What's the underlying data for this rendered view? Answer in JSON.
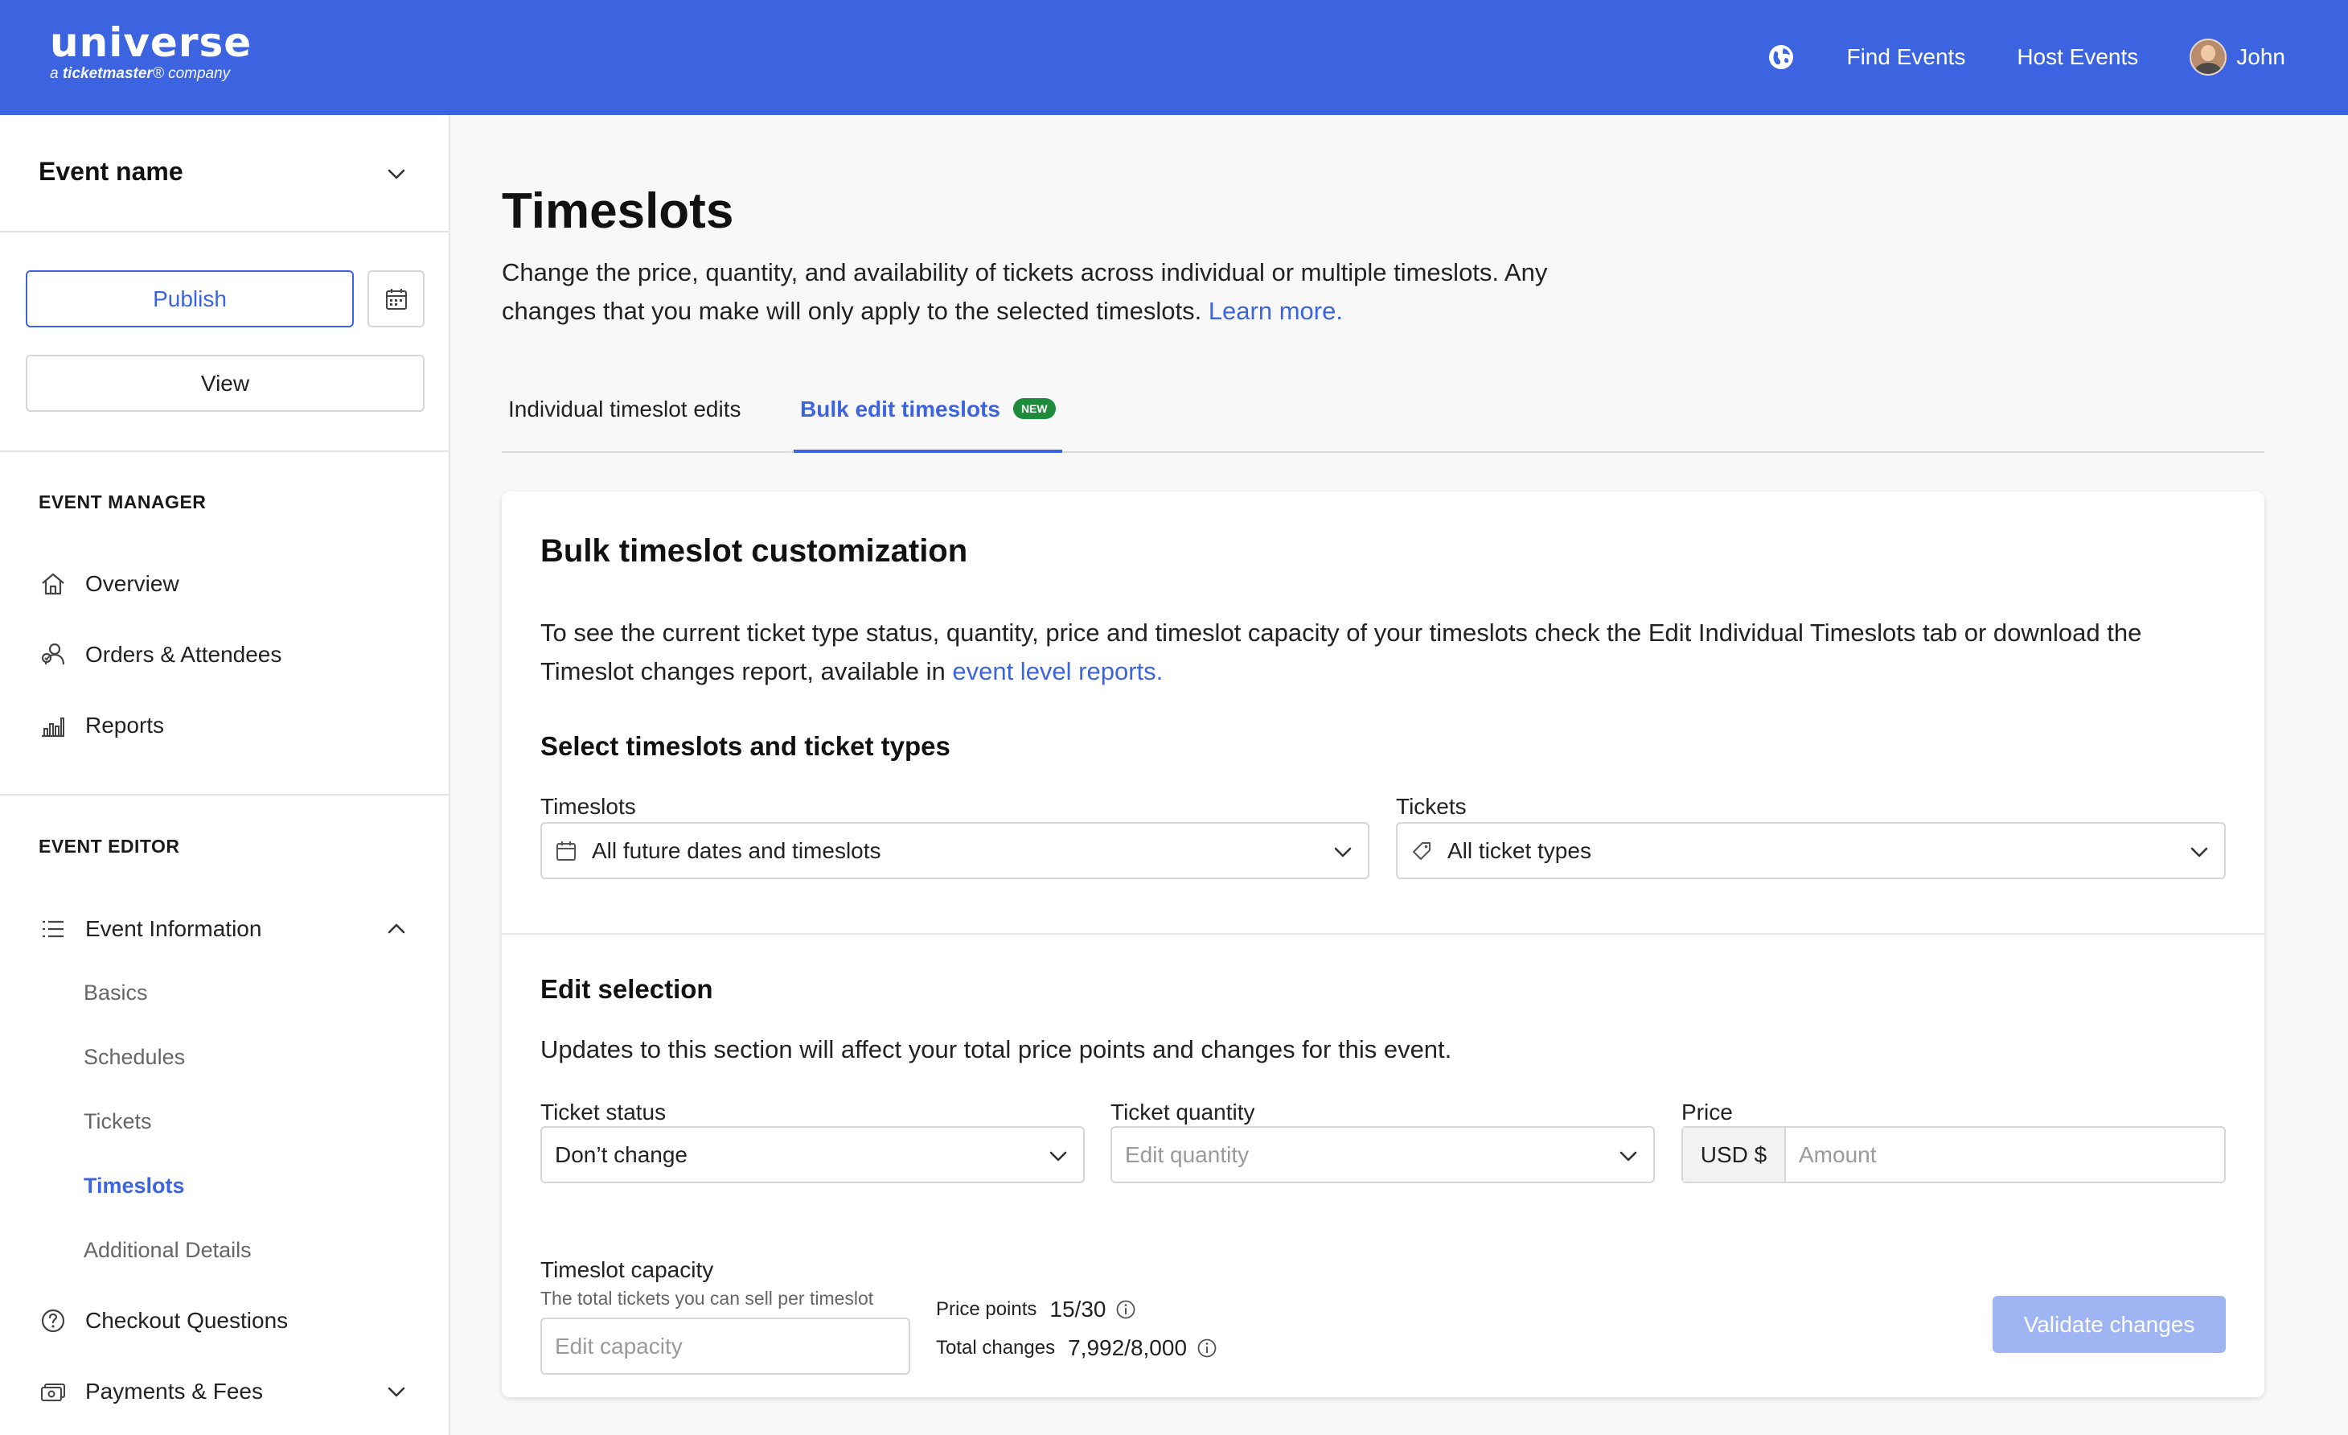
{
  "header": {
    "logo_main": "universe",
    "logo_sub_prefix": "a ",
    "logo_sub_brand": "ticketmaster",
    "logo_sub_suffix": "® company",
    "nav": {
      "find_events": "Find Events",
      "host_events": "Host Events",
      "user_name": "John"
    }
  },
  "sidebar": {
    "event_selector": "Event name",
    "publish_label": "Publish",
    "view_label": "View",
    "event_manager_heading": "EVENT MANAGER",
    "manager_items": [
      {
        "label": "Overview",
        "icon": "home-icon"
      },
      {
        "label": "Orders & Attendees",
        "icon": "attendees-icon"
      },
      {
        "label": "Reports",
        "icon": "bar-chart-icon"
      }
    ],
    "event_editor_heading": "EVENT EDITOR",
    "event_information": "Event Information",
    "sub_items": [
      {
        "label": "Basics",
        "active": false
      },
      {
        "label": "Schedules",
        "active": false
      },
      {
        "label": "Tickets",
        "active": false
      },
      {
        "label": "Timeslots",
        "active": true
      },
      {
        "label": "Additional Details",
        "active": false
      }
    ],
    "checkout_questions": "Checkout Questions",
    "payments_fees": "Payments & Fees"
  },
  "main": {
    "title": "Timeslots",
    "description": "Change the price, quantity, and availability of tickets across individual or multiple timeslots. Any changes that you make will only apply to the selected timeslots.",
    "learn_more": "Learn more.",
    "tabs": [
      {
        "label": "Individual timeslot edits",
        "active": false
      },
      {
        "label": "Bulk edit timeslots",
        "active": true,
        "badge": "NEW"
      }
    ],
    "card": {
      "title": "Bulk timeslot customization",
      "description": "To see the current ticket type status, quantity, price and timeslot capacity of your timeslots check the Edit Individual Timeslots tab or download the Timeslot changes report, available in",
      "reports_link": "event level reports.",
      "select_heading": "Select timeslots and ticket types",
      "timeslots_label": "Timeslots",
      "timeslots_value": "All future dates and timeslots",
      "tickets_label": "Tickets",
      "tickets_value": "All ticket types",
      "edit_heading": "Edit selection",
      "edit_description": "Updates to this section will affect your total price points and changes for this event.",
      "ticket_status_label": "Ticket status",
      "ticket_status_value": "Don’t change",
      "ticket_quantity_label": "Ticket quantity",
      "ticket_quantity_placeholder": "Edit quantity",
      "price_label": "Price",
      "price_currency": "USD $",
      "price_placeholder": "Amount",
      "capacity_label": "Timeslot capacity",
      "capacity_helper": "The total tickets you can sell per timeslot",
      "capacity_placeholder": "Edit capacity",
      "price_points_label": "Price points",
      "price_points_value": "15/30",
      "total_changes_label": "Total changes",
      "total_changes_value": "7,992/8,000",
      "validate_label": "Validate changes"
    }
  },
  "colors": {
    "brand": "#3d64e0",
    "badge_green": "#1e8a3c",
    "button_disabled": "#9fb4f2"
  }
}
